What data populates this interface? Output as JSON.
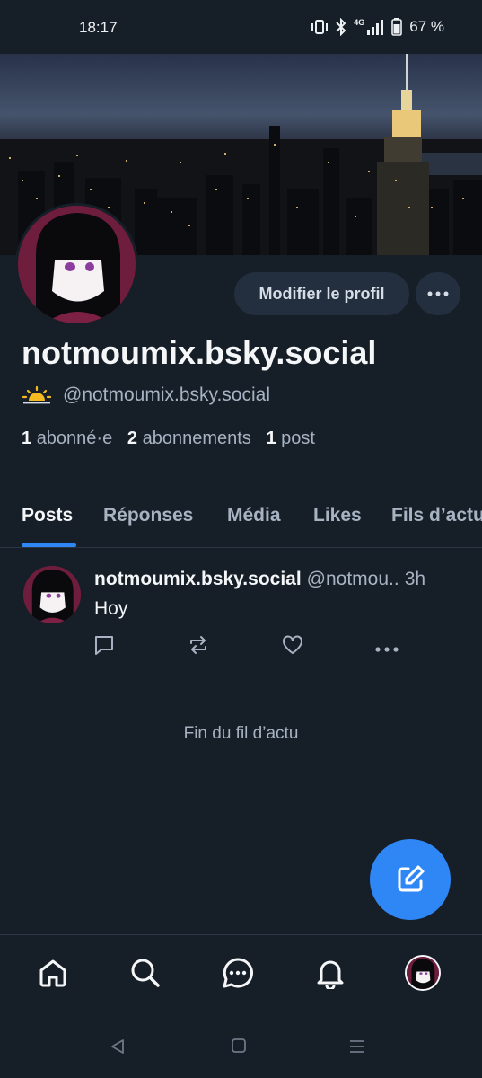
{
  "status_bar": {
    "time": "18:17",
    "network": "4G",
    "battery": "67 %"
  },
  "profile": {
    "edit_button": "Modifier le profil",
    "display_name": "notmoumix.bsky.social",
    "handle": "@notmoumix.bsky.social",
    "followers_count": "1",
    "followers_label": "abonné·e",
    "following_count": "2",
    "following_label": "abonnements",
    "posts_count": "1",
    "posts_label": "post"
  },
  "tabs": [
    {
      "label": "Posts",
      "active": true
    },
    {
      "label": "Réponses"
    },
    {
      "label": "Média"
    },
    {
      "label": "Likes"
    },
    {
      "label": "Fils d’actu"
    }
  ],
  "post": {
    "author": "notmoumix.bsky.social",
    "handle": "@notmou..",
    "time": "3h",
    "text": "Hoy"
  },
  "feed_end": "Fin du fil d’actu",
  "colors": {
    "accent": "#2f87f5",
    "background": "#161e27",
    "muted": "#a7b3c2"
  },
  "icons": {
    "bottom_nav": [
      "home-icon",
      "search-icon",
      "chat-icon",
      "bell-icon",
      "profile-avatar"
    ],
    "post_actions": [
      "reply-icon",
      "repost-icon",
      "like-icon",
      "more-icon"
    ]
  }
}
